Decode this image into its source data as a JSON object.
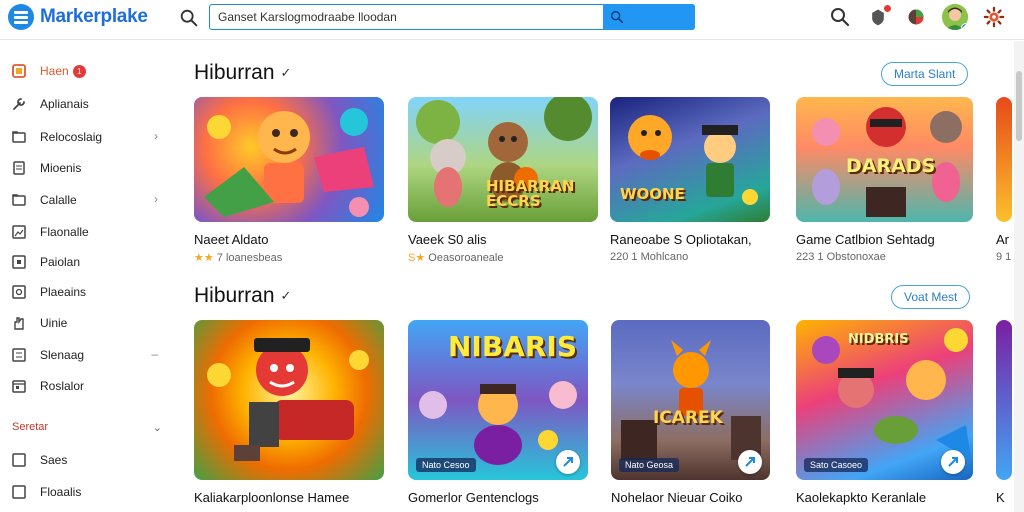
{
  "app": {
    "title": "Markerplake",
    "colors": {
      "brand": "#1e88e5",
      "accent": "#e4572e",
      "pill_border": "#4aa3df"
    }
  },
  "search": {
    "value": "Ganset Karslogmodraabe lloodan",
    "placeholder": ""
  },
  "header_icons": [
    "search-icon",
    "notification-icon",
    "extension-icon",
    "avatar",
    "settings-icon"
  ],
  "sidebar": {
    "items": [
      {
        "label": "Haen",
        "icon": "home-icon",
        "active": true,
        "badge": "1"
      },
      {
        "label": "Aplianais",
        "icon": "wrench-icon"
      },
      {
        "label": "Relocoslaig",
        "icon": "folder-icon",
        "chevron": "›"
      },
      {
        "label": "Mioenis",
        "icon": "document-icon"
      },
      {
        "label": "Calalle",
        "icon": "folder-icon",
        "chevron": "›"
      },
      {
        "label": "Flaonalle",
        "icon": "image-icon"
      },
      {
        "label": "Paiolan",
        "icon": "square-icon"
      },
      {
        "label": "Plaeains",
        "icon": "gear-box-icon"
      },
      {
        "label": "Uinie",
        "icon": "hand-icon"
      },
      {
        "label": "Slenaag",
        "icon": "list-icon",
        "chevron": "–"
      },
      {
        "label": "Roslalor",
        "icon": "calendar-icon"
      }
    ],
    "section": {
      "label": "Seretar",
      "chevron": "⌄"
    },
    "section_items": [
      {
        "label": "Saes",
        "icon": "checkbox-icon"
      },
      {
        "label": "Floaalis",
        "icon": "checkbox-icon"
      }
    ]
  },
  "sections": [
    {
      "title": "Hiburran",
      "chevron": "✓",
      "action": "Marta Slant",
      "cards": [
        {
          "title": "Naeet Aldato",
          "sub": "7 loanesbeas",
          "stars": "★★"
        },
        {
          "title": "Vaeek S0 alis",
          "sub": "Oeasoroaneale",
          "stars": "S★",
          "art_text": "HIBARRAN ECCRS"
        },
        {
          "title": "Raneoabe S Opliotakan,",
          "sub": "220 1 Mohlcano",
          "art_text": "WOONE"
        },
        {
          "title": "Game Catlbion Sehtadg",
          "sub": "223 1 Obstonoxae",
          "art_text": "DARADS"
        },
        {
          "title": "Ar",
          "sub": "9 1"
        }
      ]
    },
    {
      "title": "Hiburran",
      "chevron": "✓",
      "action": "Voat Mest",
      "cards": [
        {
          "title": "Kaliakarploonlonse Hamee",
          "tag": ""
        },
        {
          "title": "Gomerlor Gentenclogs",
          "tag": "Nato Cesoo",
          "art_text": "NIBARIS"
        },
        {
          "title": "Nohelaor Nieuar Coiko",
          "tag": "Nato Geosa",
          "art_text": "ICAREK"
        },
        {
          "title": "Kaolekapkto Keranlale",
          "tag": "Sato Casoeo",
          "art_text": "NIDBRIS"
        },
        {
          "title": "K"
        }
      ]
    }
  ]
}
